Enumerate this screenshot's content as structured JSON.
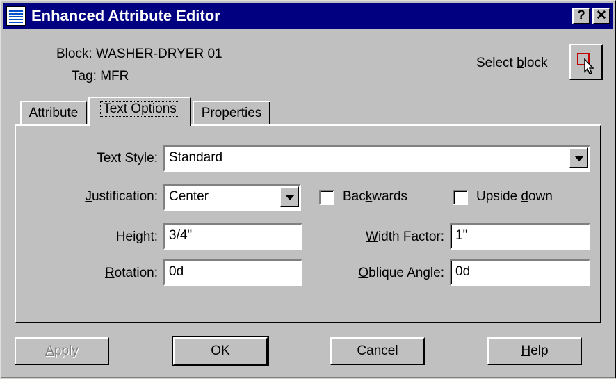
{
  "window": {
    "title": "Enhanced Attribute Editor",
    "help_btn": "?",
    "close_btn": "✕"
  },
  "header": {
    "block_label": "Block: WASHER-DRYER 01",
    "tag_label": "Tag: MFR",
    "select_block_pre": "Select ",
    "select_block_ul": "b",
    "select_block_post": "lock"
  },
  "tabs": [
    {
      "label": "Attribute"
    },
    {
      "label": "Text Options"
    },
    {
      "label": "Properties"
    }
  ],
  "text_style": {
    "pre": "Text ",
    "ul": "S",
    "post": "tyle:",
    "value": "Standard"
  },
  "justification": {
    "pre": "",
    "ul": "J",
    "post": "ustification:",
    "value": "Center"
  },
  "backwards": {
    "pre": "Bac",
    "ul": "k",
    "post": "wards",
    "checked": false
  },
  "upside_down": {
    "pre": "Upside ",
    "ul": "d",
    "post": "own",
    "checked": false
  },
  "height": {
    "pre": "Hei",
    "ul": "g",
    "post": "ht:",
    "value": "3/4\""
  },
  "width_factor": {
    "pre": "",
    "ul": "W",
    "post": "idth Factor:",
    "value": "1\""
  },
  "rotation": {
    "pre": "",
    "ul": "R",
    "post": "otation:",
    "value": "0d"
  },
  "oblique": {
    "pre": "",
    "ul": "O",
    "post": "blique Angle:",
    "value": "0d"
  },
  "buttons": {
    "apply": {
      "pre": "",
      "ul": "A",
      "post": "pply"
    },
    "ok": "OK",
    "cancel": "Cancel",
    "help": {
      "pre": "",
      "ul": "H",
      "post": "elp"
    }
  }
}
